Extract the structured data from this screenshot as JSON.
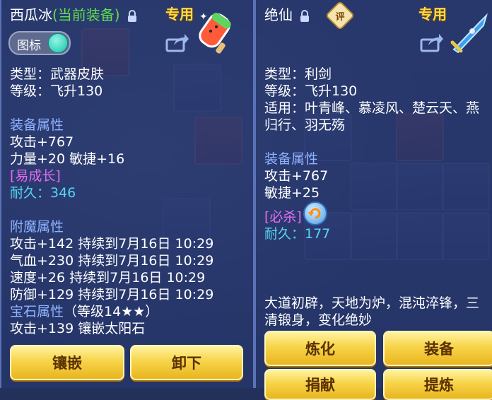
{
  "left_panel": {
    "name": "西瓜冰",
    "name_status": "(当前装备)",
    "dedicated_label": "专用",
    "toggle_label": "图标",
    "type_line": "类型：武器皮肤",
    "level_line": "等级：飞升130",
    "equip_attr_title": "装备属性",
    "attack_line": "攻击+767",
    "str_agi_line": "力量+20 敏捷+16",
    "special_tag": "[易成长]",
    "durability_line": "耐久：346",
    "enchant_title": "附魔属性",
    "enchant_lines": [
      "攻击+142 持续到7月16日 10:29",
      "气血+230 持续到7月16日 10:29",
      "速度+26 持续到7月16日 10:29",
      "防御+129 持续到7月16日 10:29"
    ],
    "gem_title": "宝石属性",
    "gem_level": "（等级14★★）",
    "gem_line": "攻击+139 镶嵌太阳石",
    "buttons": {
      "inlay": "镶嵌",
      "unequip": "卸下"
    }
  },
  "right_panel": {
    "name": "绝仙",
    "badge": "评",
    "dedicated_label": "专用",
    "type_line": "类型：利剑",
    "level_line": "等级：飞升130",
    "suitable_line1": "适用：叶青峰、慕凌风、楚云天、燕",
    "suitable_line2": "归行、羽无殇",
    "equip_attr_title": "装备属性",
    "attack_line": "攻击+767",
    "agi_line": "敏捷+25",
    "special_tag": "[必杀]",
    "durability_line": "耐久：177",
    "desc_line1": "大道初辟，天地为炉，混沌淬锋，三",
    "desc_line2": "清锻身，变化绝妙",
    "buttons": {
      "refine": "炼化",
      "equip": "装备",
      "donate": "捐献",
      "purify": "提炼"
    }
  },
  "colors": {
    "section": "#8fb2ff",
    "current_equip": "#5fe04f",
    "special": "#e46cf0",
    "durability": "#57d3f2",
    "dedicated": "#ffd84d"
  }
}
